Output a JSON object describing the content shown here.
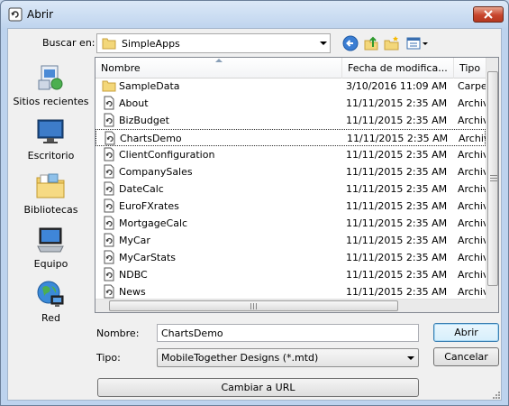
{
  "window": {
    "title": "Abrir"
  },
  "toolbar": {
    "lookin_label": "Buscar en:",
    "lookin_value": "SimpleApps",
    "buttons": [
      "back-icon",
      "up-folder-icon",
      "new-folder-icon",
      "view-menu-icon"
    ]
  },
  "places": [
    {
      "label": "Sitios recientes",
      "icon": "recent-places-icon"
    },
    {
      "label": "Escritorio",
      "icon": "desktop-icon"
    },
    {
      "label": "Bibliotecas",
      "icon": "libraries-icon"
    },
    {
      "label": "Equipo",
      "icon": "computer-icon"
    },
    {
      "label": "Red",
      "icon": "network-icon"
    }
  ],
  "columns": [
    "Nombre",
    "Fecha de modifica...",
    "Tipo"
  ],
  "files": [
    {
      "name": "SampleData",
      "date": "3/10/2016 11:09 AM",
      "type": "Carpet",
      "icon": "folder-icon"
    },
    {
      "name": "About",
      "date": "11/11/2015 2:35 AM",
      "type": "Archiv",
      "icon": "mtd-file-icon"
    },
    {
      "name": "BizBudget",
      "date": "11/11/2015 2:35 AM",
      "type": "Archiv",
      "icon": "mtd-file-icon"
    },
    {
      "name": "ChartsDemo",
      "date": "11/11/2015 2:35 AM",
      "type": "Archiv",
      "icon": "mtd-file-icon",
      "selected": true
    },
    {
      "name": "ClientConfiguration",
      "date": "11/11/2015 2:35 AM",
      "type": "Archiv",
      "icon": "mtd-file-icon"
    },
    {
      "name": "CompanySales",
      "date": "11/11/2015 2:35 AM",
      "type": "Archiv",
      "icon": "mtd-file-icon"
    },
    {
      "name": "DateCalc",
      "date": "11/11/2015 2:35 AM",
      "type": "Archiv",
      "icon": "mtd-file-icon"
    },
    {
      "name": "EuroFXrates",
      "date": "11/11/2015 2:35 AM",
      "type": "Archiv",
      "icon": "mtd-file-icon"
    },
    {
      "name": "MortgageCalc",
      "date": "11/11/2015 2:35 AM",
      "type": "Archiv",
      "icon": "mtd-file-icon"
    },
    {
      "name": "MyCar",
      "date": "11/11/2015 2:35 AM",
      "type": "Archiv",
      "icon": "mtd-file-icon"
    },
    {
      "name": "MyCarStats",
      "date": "11/11/2015 2:35 AM",
      "type": "Archiv",
      "icon": "mtd-file-icon"
    },
    {
      "name": "NDBC",
      "date": "11/11/2015 2:35 AM",
      "type": "Archiv",
      "icon": "mtd-file-icon"
    },
    {
      "name": "News",
      "date": "11/11/2015 2:35 AM",
      "type": "Archiv",
      "icon": "mtd-file-icon"
    }
  ],
  "form": {
    "name_label": "Nombre:",
    "name_value": "ChartsDemo",
    "type_label": "Tipo:",
    "type_value": "MobileTogether Designs (*.mtd)",
    "open_label": "Abrir",
    "cancel_label": "Cancelar",
    "url_label": "Cambiar a URL"
  },
  "colors": {
    "titlebar": "#bfd4ee",
    "close": "#c7452d",
    "dialog_bg": "#f0f0f0"
  }
}
